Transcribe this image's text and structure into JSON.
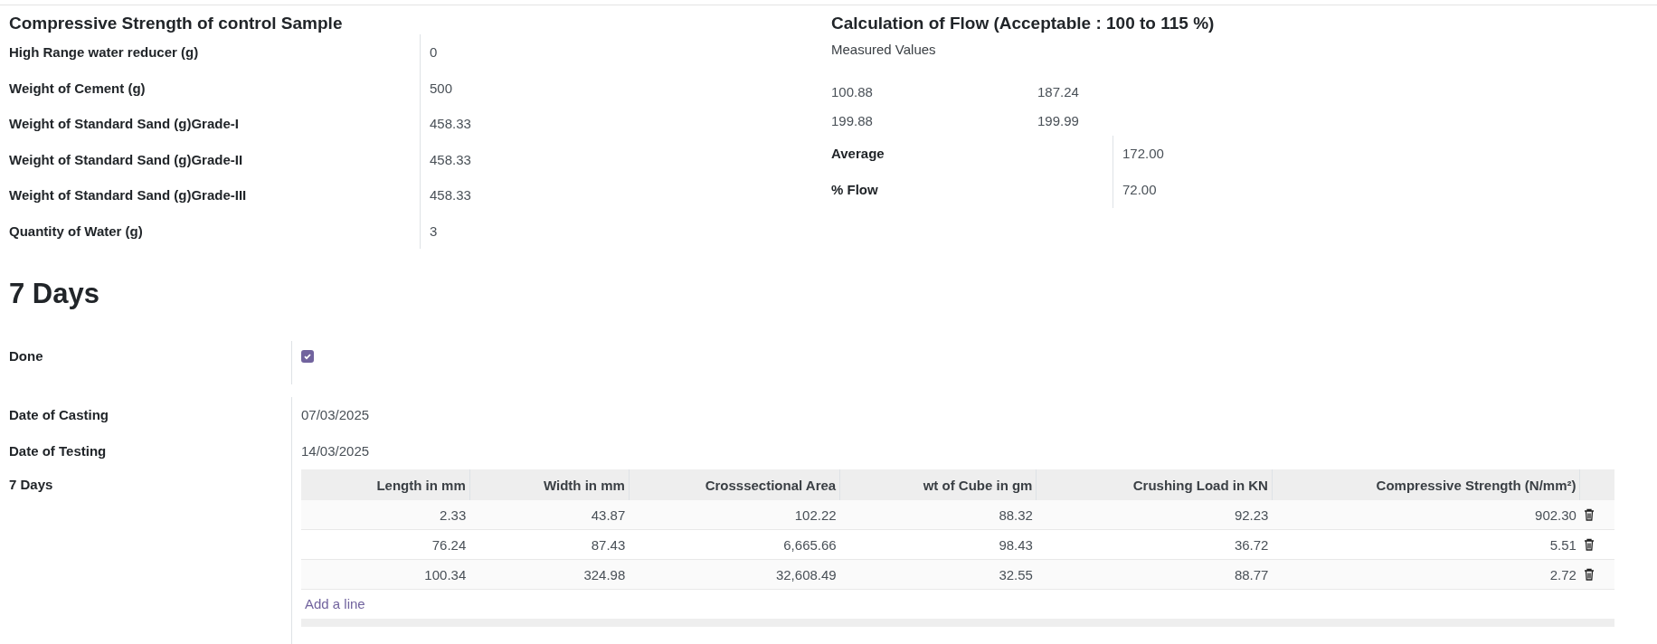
{
  "control_sample": {
    "title": "Compressive Strength of control Sample",
    "fields": [
      {
        "label": "High Range water reducer (g)",
        "value": "0"
      },
      {
        "label": "Weight of Cement (g)",
        "value": "500"
      },
      {
        "label": "Weight of Standard Sand (g)Grade-I",
        "value": "458.33"
      },
      {
        "label": "Weight of Standard Sand (g)Grade-II",
        "value": "458.33"
      },
      {
        "label": "Weight of Standard Sand (g)Grade-III",
        "value": "458.33"
      },
      {
        "label": "Quantity of Water (g)",
        "value": "3"
      }
    ]
  },
  "flow": {
    "title": "Calculation of Flow (Acceptable : 100 to 115 %)",
    "subtitle": "Measured Values",
    "measured": [
      [
        "100.88",
        "187.24"
      ],
      [
        "199.88",
        "199.99"
      ]
    ],
    "fields": [
      {
        "label": "Average",
        "value": "172.00"
      },
      {
        "label": "% Flow",
        "value": "72.00"
      }
    ]
  },
  "section": {
    "title": "7 Days",
    "done": {
      "label": "Done",
      "checked": true
    },
    "fields": [
      {
        "label": "Date of Casting",
        "value": "07/03/2025"
      },
      {
        "label": "Date of Testing",
        "value": "14/03/2025"
      }
    ],
    "table": {
      "label": "7 Days",
      "columns": [
        "Length in mm",
        "Width in mm",
        "Crosssectional Area",
        "wt of Cube in gm",
        "Crushing Load in KN",
        "Compressive Strength (N/mm²)"
      ],
      "rows": [
        [
          "2.33",
          "43.87",
          "102.22",
          "88.32",
          "92.23",
          "902.30"
        ],
        [
          "76.24",
          "87.43",
          "6,665.66",
          "98.43",
          "36.72",
          "5.51"
        ],
        [
          "100.34",
          "324.98",
          "32,608.49",
          "32.55",
          "88.77",
          "2.72"
        ]
      ],
      "add_line": "Add a line"
    }
  }
}
